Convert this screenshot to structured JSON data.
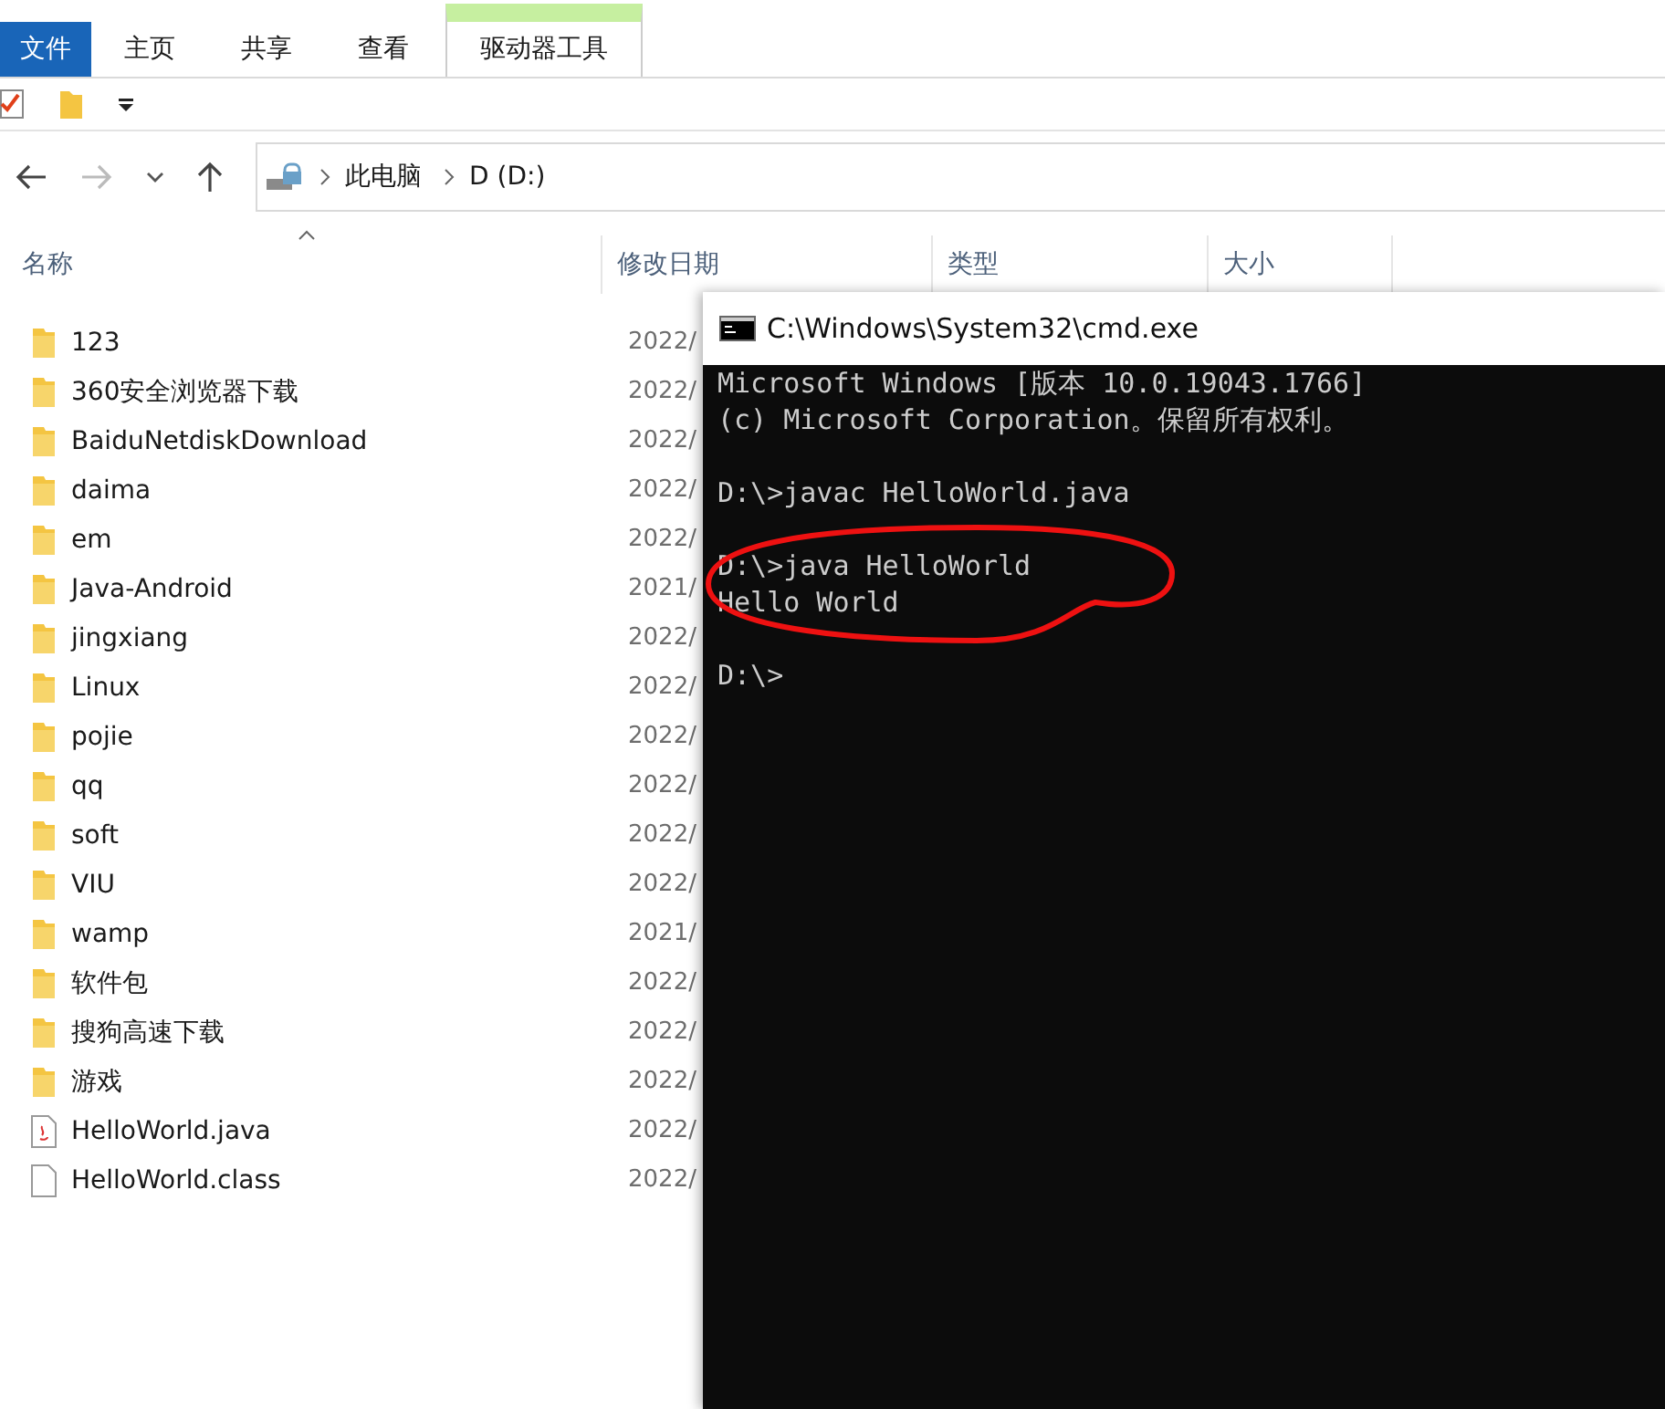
{
  "ribbon_tabs": [
    {
      "label": "文件",
      "kind": "file"
    },
    {
      "label": "主页",
      "kind": "tab"
    },
    {
      "label": "共享",
      "kind": "tab"
    },
    {
      "label": "查看",
      "kind": "tab"
    },
    {
      "label": "驱动器工具",
      "kind": "context"
    }
  ],
  "breadcrumb": [
    "此电脑",
    "D (D:)"
  ],
  "columns": [
    "名称",
    "修改日期",
    "类型",
    "大小"
  ],
  "files": [
    {
      "name": "123",
      "kind": "folder",
      "modified": "2022/"
    },
    {
      "name": "360安全浏览器下载",
      "kind": "folder",
      "modified": "2022/"
    },
    {
      "name": "BaiduNetdiskDownload",
      "kind": "folder",
      "modified": "2022/"
    },
    {
      "name": "daima",
      "kind": "folder",
      "modified": "2022/"
    },
    {
      "name": "em",
      "kind": "folder",
      "modified": "2022/"
    },
    {
      "name": "Java-Android",
      "kind": "folder",
      "modified": "2021/"
    },
    {
      "name": "jingxiang",
      "kind": "folder",
      "modified": "2022/"
    },
    {
      "name": "Linux",
      "kind": "folder",
      "modified": "2022/"
    },
    {
      "name": "pojie",
      "kind": "folder",
      "modified": "2022/"
    },
    {
      "name": "qq",
      "kind": "folder",
      "modified": "2022/"
    },
    {
      "name": "soft",
      "kind": "folder",
      "modified": "2022/"
    },
    {
      "name": "VIU",
      "kind": "folder",
      "modified": "2022/"
    },
    {
      "name": "wamp",
      "kind": "folder",
      "modified": "2021/"
    },
    {
      "name": "软件包",
      "kind": "folder",
      "modified": "2022/"
    },
    {
      "name": "搜狗高速下载",
      "kind": "folder",
      "modified": "2022/"
    },
    {
      "name": "游戏",
      "kind": "folder",
      "modified": "2022/"
    },
    {
      "name": "HelloWorld.java",
      "kind": "java",
      "modified": "2022/"
    },
    {
      "name": "HelloWorld.class",
      "kind": "file",
      "modified": "2022/"
    }
  ],
  "console": {
    "title": "C:\\Windows\\System32\\cmd.exe",
    "blocks": [
      [
        "Microsoft Windows [版本 10.0.19043.1766]",
        "(c) Microsoft Corporation。保留所有权利。"
      ],
      [
        "D:\\>javac HelloWorld.java"
      ],
      [
        "D:\\>java HelloWorld",
        "Hello World"
      ],
      [
        "D:\\>"
      ]
    ]
  }
}
